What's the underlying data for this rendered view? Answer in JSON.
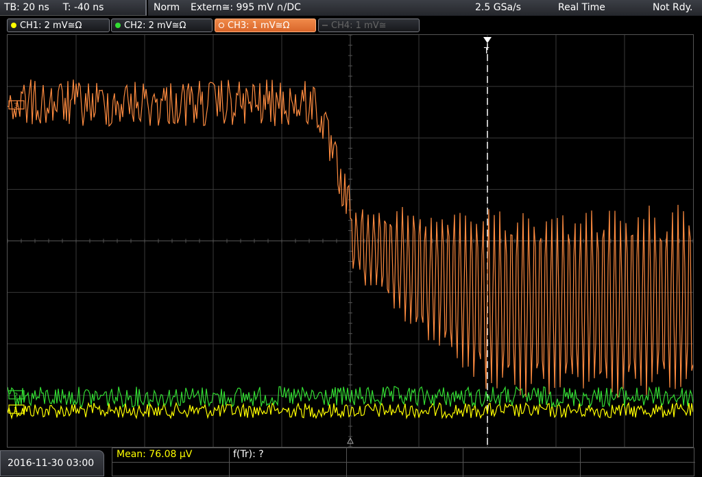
{
  "header": {
    "timebase": "TB: 20 ns",
    "trigger_offset": "T: -40 ns",
    "trigger_mode": "Norm",
    "trigger_source": "Extern≅: 995 mV ∩/DC",
    "sample_rate": "2.5 GSa/s",
    "acq_mode": "Real Time",
    "status": "Not Rdy."
  },
  "channels": [
    {
      "label": "CH1: 2 mV≅Ω",
      "color": "#ffff00",
      "state": "on"
    },
    {
      "label": "CH2: 2 mV≅Ω",
      "color": "#33dd33",
      "state": "on"
    },
    {
      "label": "CH3: 1 mV≅Ω",
      "color": "#ff8c40",
      "state": "active"
    },
    {
      "label": "CH4: 1 mV≅",
      "color": "#666666",
      "state": "off"
    }
  ],
  "markers": {
    "ch3_ref": "3",
    "ch2_ref": "2",
    "ch1_ref": "1",
    "trigger_mark": "T"
  },
  "footer": {
    "datetime": "2016-11-30 03:00",
    "mean": "Mean: 76.08 μV",
    "f_tr": "f(Tr): ?"
  },
  "colors": {
    "ch1": "#ffff00",
    "ch2": "#33dd33",
    "ch3": "#ff8c40",
    "grid": "#3a3a3a",
    "trigger_line": "#ffffff"
  }
}
